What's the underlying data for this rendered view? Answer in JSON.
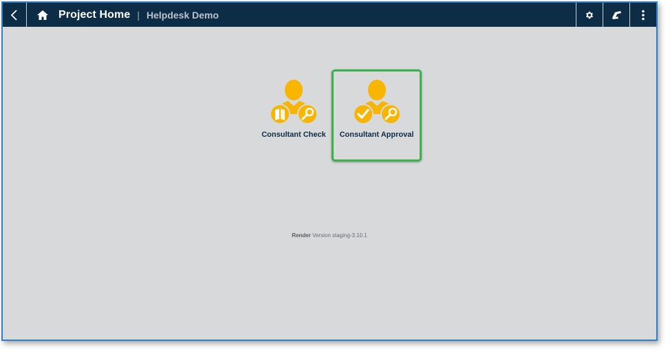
{
  "header": {
    "title": "Project Home",
    "separator": "|",
    "subtitle": "Helpdesk Demo"
  },
  "icons": {
    "back": "chevron-left-icon",
    "home": "home-icon",
    "settings": "gear-icon",
    "phone": "phone-icon",
    "more": "more-vert-icon"
  },
  "tiles": [
    {
      "label": "Consultant Check",
      "icon": "consultant-check-icon",
      "selected": false
    },
    {
      "label": "Consultant Approval",
      "icon": "consultant-approval-icon",
      "selected": true
    }
  ],
  "footer": {
    "app": "Render",
    "version": "Version staging-3.10.1"
  },
  "colors": {
    "topbar": "#0d2c46",
    "background": "#d8d9db",
    "accent_icon": "#f7b500",
    "selection_border": "#3ab04a",
    "frame_border": "#2f7fc7"
  }
}
